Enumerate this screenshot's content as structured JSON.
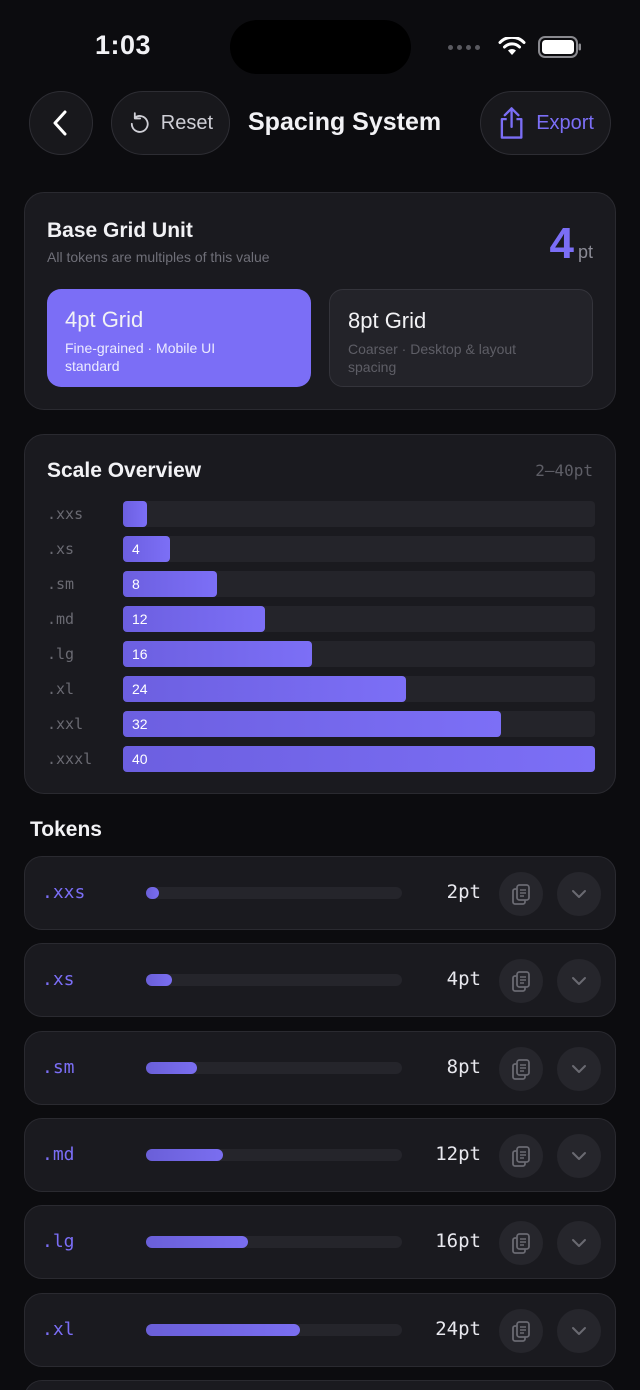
{
  "status": {
    "time": "1:03"
  },
  "nav": {
    "reset_label": "Reset",
    "title": "Spacing System",
    "export_label": "Export"
  },
  "base_grid": {
    "title": "Base Grid Unit",
    "subtitle": "All tokens are multiples of this value",
    "value": "4",
    "unit": "pt",
    "options": [
      {
        "title": "4pt Grid",
        "desc": "Fine-grained · Mobile UI standard",
        "selected": true
      },
      {
        "title": "8pt Grid",
        "desc": "Coarser · Desktop & layout spacing",
        "selected": false
      }
    ]
  },
  "scale": {
    "title": "Scale Overview",
    "range": "2–40pt",
    "max": 40,
    "rows": [
      {
        "name": ".xxs",
        "value": 2,
        "label": ""
      },
      {
        "name": ".xs",
        "value": 4,
        "label": "4"
      },
      {
        "name": ".sm",
        "value": 8,
        "label": "8"
      },
      {
        "name": ".md",
        "value": 12,
        "label": "12"
      },
      {
        "name": ".lg",
        "value": 16,
        "label": "16"
      },
      {
        "name": ".xl",
        "value": 24,
        "label": "24"
      },
      {
        "name": ".xxl",
        "value": 32,
        "label": "32"
      },
      {
        "name": ".xxxl",
        "value": 40,
        "label": "40"
      }
    ]
  },
  "tokens": {
    "title": "Tokens",
    "items": [
      {
        "name": ".xxs",
        "value": "2pt",
        "level": 0.05
      },
      {
        "name": ".xs",
        "value": "4pt",
        "level": 0.1
      },
      {
        "name": ".sm",
        "value": "8pt",
        "level": 0.2
      },
      {
        "name": ".md",
        "value": "12pt",
        "level": 0.3
      },
      {
        "name": ".lg",
        "value": "16pt",
        "level": 0.4
      },
      {
        "name": ".xl",
        "value": "24pt",
        "level": 0.6
      }
    ]
  },
  "colors": {
    "accent": "#7b6ef6",
    "background": "#0c0c0f",
    "card": "#1a1a1f"
  }
}
